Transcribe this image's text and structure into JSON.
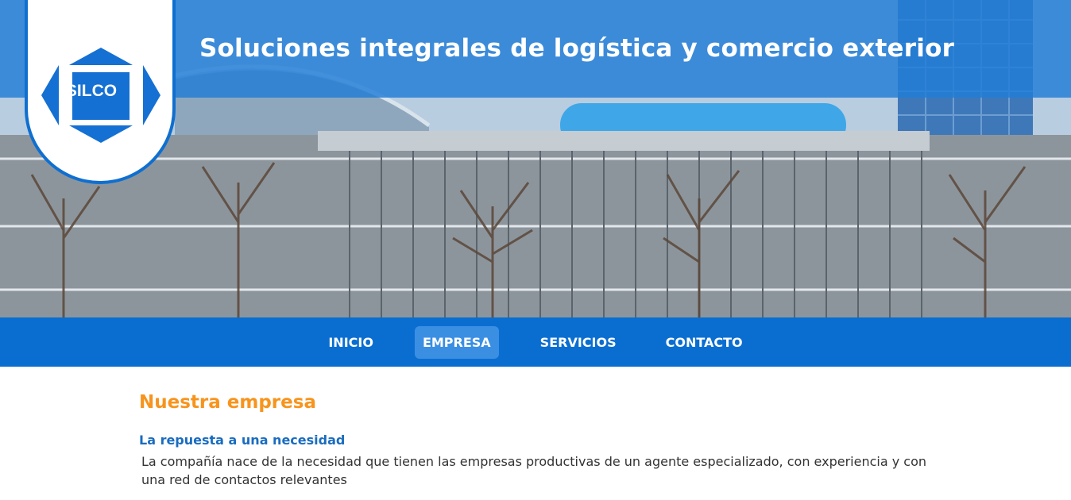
{
  "header": {
    "title": "Soluciones integrales de logística y comercio exterior",
    "logo_text": "SILCO",
    "background_image": "glass-office-building-with-bare-trees"
  },
  "nav": {
    "items": [
      {
        "label": "INICIO",
        "active": false
      },
      {
        "label": "EMPRESA",
        "active": true
      },
      {
        "label": "SERVICIOS",
        "active": false
      },
      {
        "label": "CONTACTO",
        "active": false
      }
    ]
  },
  "main": {
    "heading": "Nuestra empresa",
    "subheading": "La repuesta a una necesidad",
    "paragraph": "La compañía nace de la necesidad que tienen las empresas productivas de un agente especializado, con experiencia y con una red de contactos relevantes"
  },
  "colors": {
    "brand_blue": "#0a6ed1",
    "active_tab": "#3b8fe3",
    "heading_orange": "#f7941d",
    "subheading_blue": "#1a6cc0"
  }
}
